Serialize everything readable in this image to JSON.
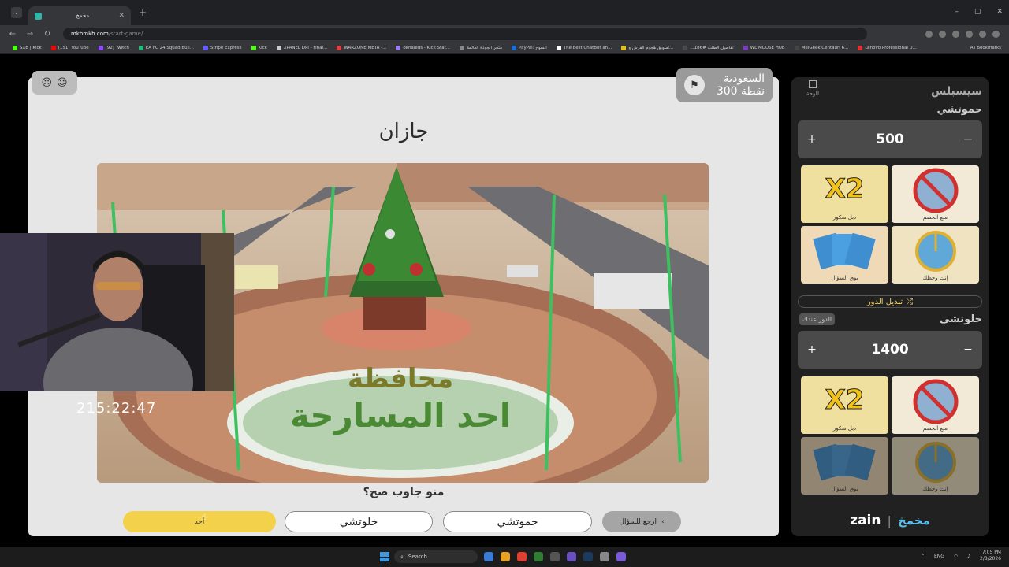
{
  "browser": {
    "tab_title": "مخمخ",
    "url_host": "mkhmkh.com",
    "url_path": "/start-game/",
    "all_bookmarks": "All Bookmarks",
    "bookmarks": [
      {
        "label": "SXB | Kick",
        "color": "#53fc18"
      },
      {
        "label": "(151) YouTube",
        "color": "#ff0000"
      },
      {
        "label": "(92) Twitch",
        "color": "#9146ff"
      },
      {
        "label": "EA FC 24 Squad Buil...",
        "color": "#2fb67c"
      },
      {
        "label": "Stripe Express",
        "color": "#635bff"
      },
      {
        "label": "Kick",
        "color": "#53fc18"
      },
      {
        "label": "XPANEL DPI - Final...",
        "color": "#cccccc"
      },
      {
        "label": "WARZONE META -...",
        "color": "#e04040"
      },
      {
        "label": "okhaleds - Kick Stat...",
        "color": "#9a7cf0"
      },
      {
        "label": "متجر الجودة العالمة",
        "color": "#888888"
      },
      {
        "label": "PayPal: السوح",
        "color": "#1f6fd0"
      },
      {
        "label": "The best ChatBot an...",
        "color": "#ffffff"
      },
      {
        "label": "تسويق هجوم الفرش و...",
        "color": "#e0c020"
      },
      {
        "label": "...186# تفاصيل الطلب",
        "color": "#4a4a4a"
      },
      {
        "label": "WL MOUSE HUB",
        "color": "#7a3cc0"
      },
      {
        "label": "MelGeek Centauri 6...",
        "color": "#444444"
      },
      {
        "label": "Lenovo Professional U...",
        "color": "#e03030"
      }
    ]
  },
  "game": {
    "question_title": "جازان",
    "prompt": "منو جاوب صح؟",
    "team_name": "السعودية",
    "team_points": "300 نقطة",
    "answers": {
      "none": "أحد",
      "team2": "خلوتشي",
      "team1": "حموتشي",
      "back": "ارجع للسؤال"
    },
    "image_texts": {
      "line1": "محافظة",
      "line2": "احد المسارحة"
    }
  },
  "panel": {
    "title": "سيسبلس",
    "board_link": "للوحة",
    "team1": {
      "name": "حموتشي",
      "score": "500"
    },
    "team2": {
      "name": "خلوتشي",
      "score": "1400",
      "turn": "الدور عندك"
    },
    "switch_turn": "تبديل الدور",
    "cards": {
      "x2": "X2",
      "x2_label": "دبل سكور",
      "block_label": "منع الخصم",
      "cards_label": "بوق السؤال",
      "wheel_label": "إنت وحظك"
    },
    "brand": {
      "zain": "zain",
      "logo": "مخمخ"
    }
  },
  "overlay": {
    "timer": "215:22:47"
  },
  "taskbar": {
    "search": "Search",
    "lang": "ENG",
    "time": "7:05 PM",
    "date": "2/8/2026"
  }
}
